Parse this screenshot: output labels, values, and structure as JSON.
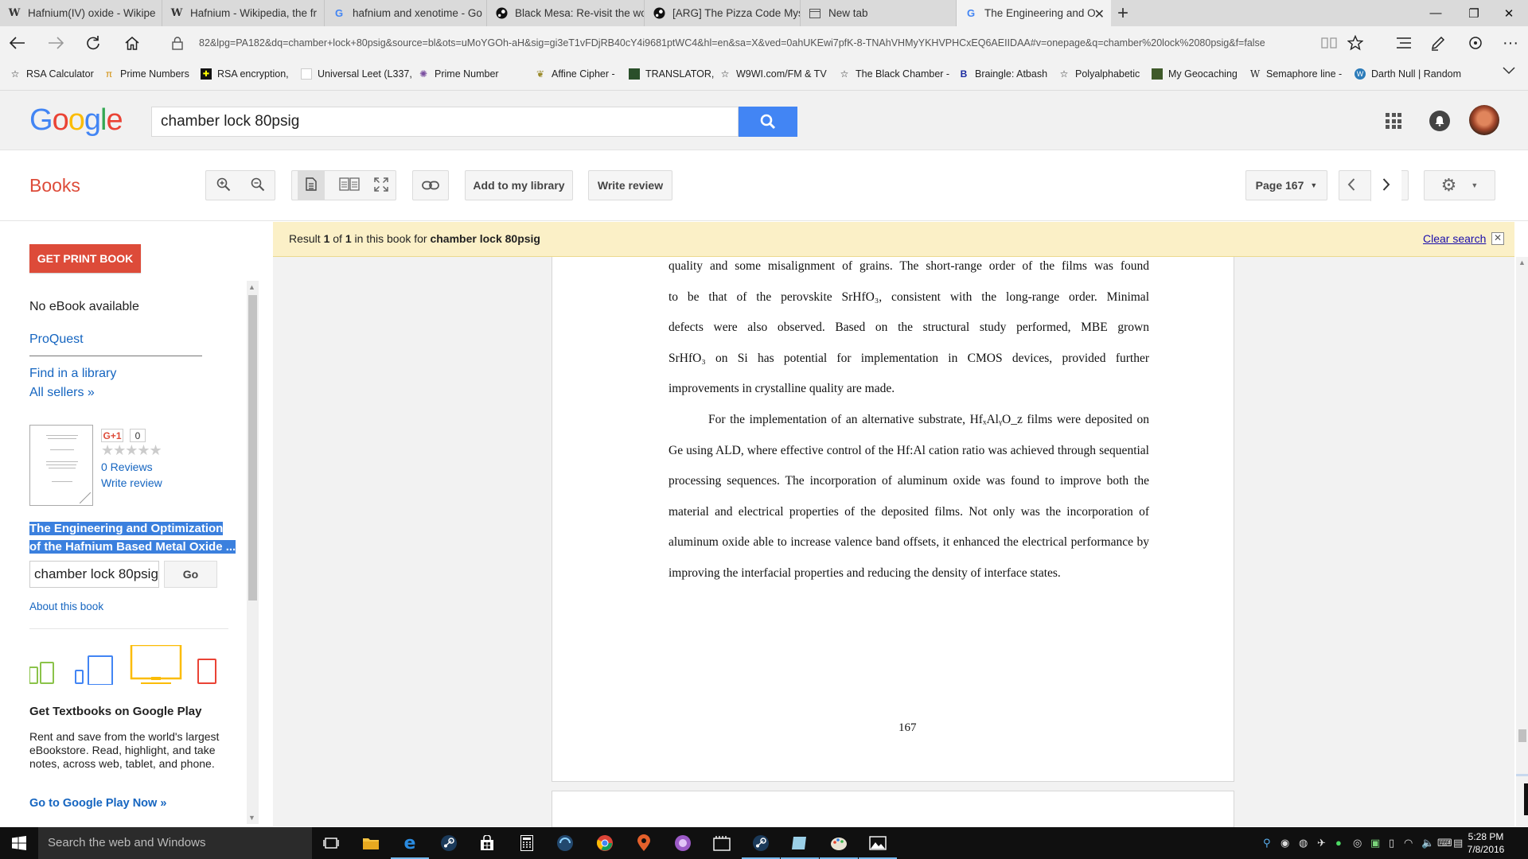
{
  "browser": {
    "tabs": [
      {
        "title": "Hafnium(IV) oxide - Wikipe",
        "icon": "wikipedia-icon"
      },
      {
        "title": "Hafnium - Wikipedia, the fr",
        "icon": "wikipedia-icon"
      },
      {
        "title": "hafnium and xenotime - Go",
        "icon": "google-icon"
      },
      {
        "title": "Black Mesa: Re-visit the wor",
        "icon": "steam-icon"
      },
      {
        "title": "[ARG] The Pizza Code Myst",
        "icon": "steam-icon"
      },
      {
        "title": "New tab",
        "icon": "newtab-icon"
      },
      {
        "title": "The Engineering and Op",
        "icon": "google-icon",
        "active": true
      }
    ],
    "url": "82&lpg=PA182&dq=chamber+lock+80psig&source=bl&ots=uMoYGOh-aH&sig=gi3eT1vFDjRB40cY4i9681ptWC4&hl=en&sa=X&ved=0ahUKEwi7pfK-8-TNAhVHMyYKHVPHCxEQ6AEIIDAA#v=onepage&q=chamber%20lock%2080psig&f=false",
    "favorites": [
      {
        "label": "RSA Calculator",
        "icon": "star-icon"
      },
      {
        "label": "Prime Numbers",
        "icon": "pi-icon"
      },
      {
        "label": "RSA encryption,",
        "icon": "puzzle-icon"
      },
      {
        "label": "Universal Leet (L337,",
        "icon": "blank-page-icon"
      },
      {
        "label": "Prime Number",
        "icon": "atom-icon"
      },
      {
        "label": "Affine Cipher -",
        "icon": "leaf-icon"
      },
      {
        "label": "TRANSLATOR,",
        "icon": "translator-icon"
      },
      {
        "label": "W9WI.com/FM & TV",
        "icon": "star-icon"
      },
      {
        "label": "The Black Chamber -",
        "icon": "star-icon"
      },
      {
        "label": "Braingle: Atbash",
        "icon": "braingle-icon"
      },
      {
        "label": "Polyalphabetic",
        "icon": "star-icon"
      },
      {
        "label": "My Geocaching",
        "icon": "geocaching-icon"
      },
      {
        "label": "Semaphore line -",
        "icon": "wikipedia-icon"
      },
      {
        "label": "Darth Null | Random",
        "icon": "wordpress-icon"
      }
    ]
  },
  "google": {
    "logo": "Google",
    "query": "chamber lock 80psig"
  },
  "books": {
    "title": "Books",
    "add_library": "Add to my library",
    "write_review": "Write review",
    "page_select": "Page 167"
  },
  "sidebar": {
    "get_print": "GET PRINT BOOK",
    "no_ebook": "No eBook available",
    "proquest": "ProQuest",
    "find_library": "Find in a library",
    "all_sellers": "All sellers »",
    "gplus": "G+1",
    "gplus_count": "0",
    "reviews": "0 Reviews",
    "write_review": "Write review",
    "book_title": "The Engineering and Optimization of the Hafnium Based Metal Oxide ...",
    "search_value": "chamber lock 80psig",
    "go": "Go",
    "about": "About this book",
    "promo_title": "Get Textbooks on Google Play",
    "promo_text": "Rent and save from the world's largest eBookstore. Read, highlight, and take notes, across web, tablet, and phone.",
    "promo_link": "Go to Google Play Now »"
  },
  "result": {
    "prefix": "Result ",
    "num": "1",
    "of": " of ",
    "total": "1",
    "mid": " in this book for ",
    "query": "chamber lock 80psig",
    "clear": "Clear search"
  },
  "page": {
    "para1_lines": [
      "quality and some misalignment of grains.  The short-range order of the films was found",
      "to be that of the perovskite SrHfO₃, consistent with the long-range order.  Minimal",
      "defects were also observed.  Based on the structural study performed, MBE grown",
      "SrHfO₃ on Si has potential for implementation in CMOS devices, provided further",
      "improvements in crystalline quality are made."
    ],
    "para2": "For the implementation of an alternative substrate, HfₓAlᵧO_z films were deposited on Ge using ALD, where effective control of the Hf:Al cation ratio was achieved through sequential processing sequences.  The incorporation of aluminum oxide was found to improve both the material and electrical properties of the deposited films.  Not only was the incorporation of aluminum oxide able to increase valence band offsets, it enhanced the electrical performance by improving the interfacial properties and reducing the density of interface states.",
    "number": "167"
  },
  "taskbar": {
    "search_placeholder": "Search the web and Windows",
    "time": "5:28 PM",
    "date": "7/8/2016"
  }
}
